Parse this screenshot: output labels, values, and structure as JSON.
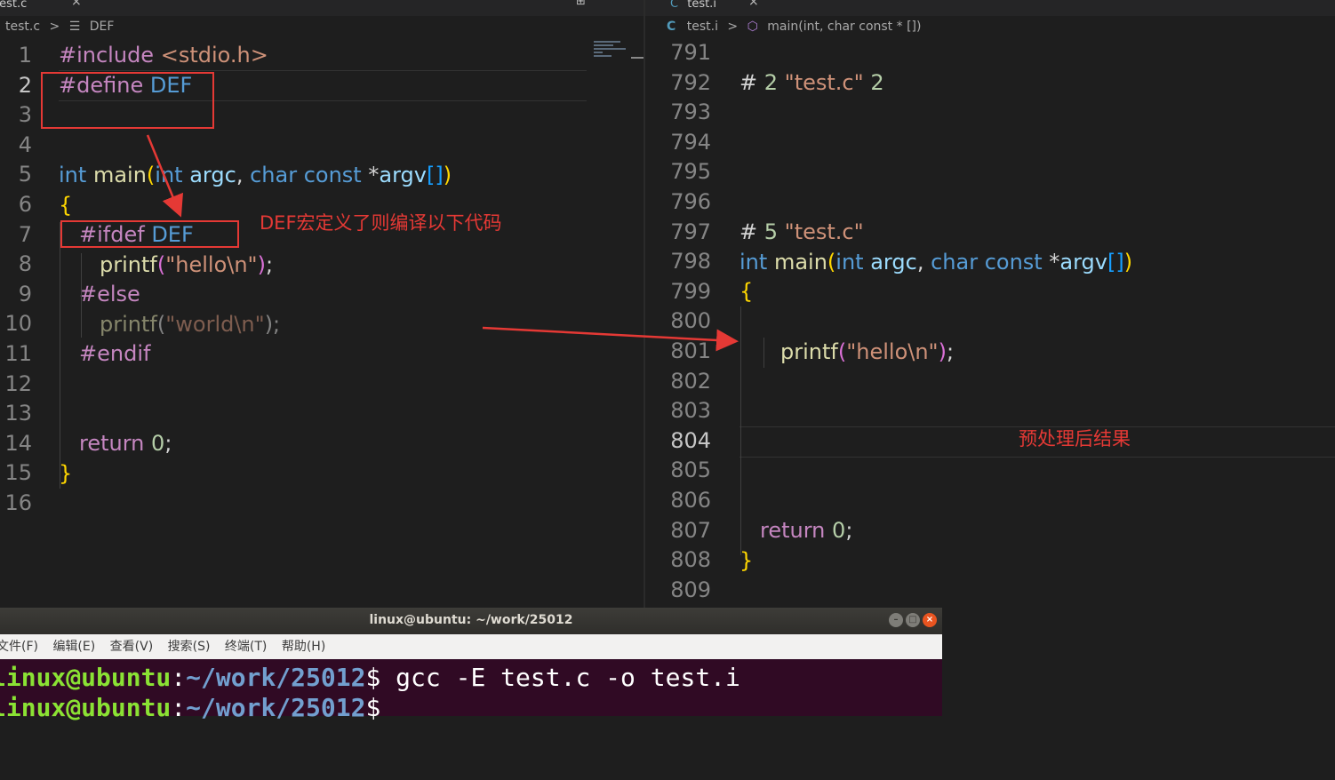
{
  "left_editor": {
    "tab_label": "test.c",
    "tab_close": "×",
    "split_icon": "⊞",
    "breadcrumb_file": "test.c",
    "breadcrumb_sep": ">",
    "breadcrumb_symbol_icon": "☰",
    "breadcrumb_symbol": "DEF",
    "line_numbers": [
      "1",
      "2",
      "3",
      "4",
      "5",
      "6",
      "7",
      "8",
      "9",
      "10",
      "11",
      "12",
      "13",
      "14",
      "15",
      "16"
    ],
    "active_line": "2"
  },
  "right_editor": {
    "tab_label": "test.i",
    "tab_close": "×",
    "breadcrumb_icon": "C",
    "breadcrumb_file": "test.i",
    "breadcrumb_sep": ">",
    "breadcrumb_symbol_icon": "⬡",
    "breadcrumb_symbol": "main(int, char const * [])",
    "line_numbers": [
      "791",
      "792",
      "793",
      "794",
      "795",
      "796",
      "797",
      "798",
      "799",
      "800",
      "801",
      "802",
      "803",
      "804",
      "805",
      "806",
      "807",
      "808",
      "809"
    ],
    "active_line": "804"
  },
  "annotations": {
    "ifdef_note": "DEF宏定义了则编译以下代码",
    "result_note": "预处理后结果"
  },
  "terminal": {
    "title": "linux@ubuntu: ~/work/25012",
    "menu": [
      "文件(F)",
      "编辑(E)",
      "查看(V)",
      "搜索(S)",
      "终端(T)",
      "帮助(H)"
    ],
    "prompt_user": "linux@ubuntu",
    "prompt_sep": ":",
    "prompt_path": "~/work/25012",
    "prompt_symbol": "$",
    "command": " gcc -E test.c -o test.i",
    "minimize": "–",
    "maximize": "□",
    "close": "×"
  },
  "colors": {
    "annotation": "#e53935",
    "keyword": "#569cd6",
    "preprocessor": "#c586c0",
    "string": "#ce9178",
    "function": "#dcdcaa"
  }
}
